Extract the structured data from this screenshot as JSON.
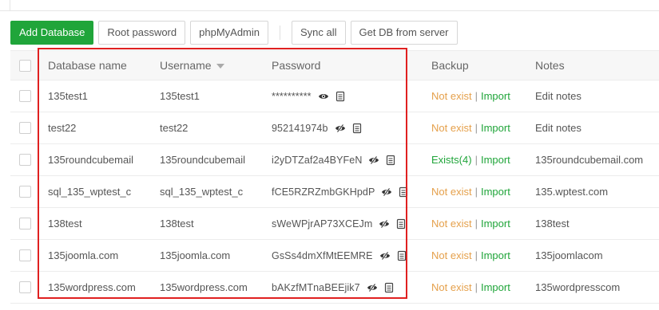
{
  "toolbar": {
    "add_database": "Add Database",
    "root_password": "Root password",
    "phpmyadmin": "phpMyAdmin",
    "sync_all": "Sync all",
    "get_db_from_server": "Get DB from server"
  },
  "columns": {
    "name": "Database name",
    "user": "Username",
    "password": "Password",
    "backup": "Backup",
    "notes": "Notes"
  },
  "backup_import": "Import",
  "rows": [
    {
      "name": "135test1",
      "user": "135test1",
      "password": "**********",
      "password_hidden": true,
      "backup": "Not exist",
      "backup_status": "missing",
      "notes": "Edit notes"
    },
    {
      "name": "test22",
      "user": "test22",
      "password": "952141974b",
      "password_hidden": false,
      "backup": "Not exist",
      "backup_status": "missing",
      "notes": "Edit notes"
    },
    {
      "name": "135roundcubemail",
      "user": "135roundcubemail",
      "password": "i2yDTZaf2a4BYFeN",
      "password_hidden": false,
      "backup": "Exists(4)",
      "backup_status": "exists",
      "notes": "135roundcubemail.com"
    },
    {
      "name": "sql_135_wptest_c",
      "user": "sql_135_wptest_c",
      "password": "fCE5RZRZmbGKHpdP",
      "password_hidden": false,
      "backup": "Not exist",
      "backup_status": "missing",
      "notes": "135.wptest.com"
    },
    {
      "name": "138test",
      "user": "138test",
      "password": "sWeWPjrAP73XCEJm",
      "password_hidden": false,
      "backup": "Not exist",
      "backup_status": "missing",
      "notes": "138test"
    },
    {
      "name": "135joomla.com",
      "user": "135joomla.com",
      "password": "GsSs4dmXfMtEEMRE",
      "password_hidden": false,
      "backup": "Not exist",
      "backup_status": "missing",
      "notes": "135joomlacom"
    },
    {
      "name": "135wordpress.com",
      "user": "135wordpress.com",
      "password": "bAKzfMTnaBEEjik7",
      "password_hidden": false,
      "backup": "Not exist",
      "backup_status": "missing",
      "notes": "135wordpresscom"
    }
  ],
  "colors": {
    "accent": "#20a53a",
    "warning": "#e5a04b",
    "highlight": "#e02020"
  }
}
